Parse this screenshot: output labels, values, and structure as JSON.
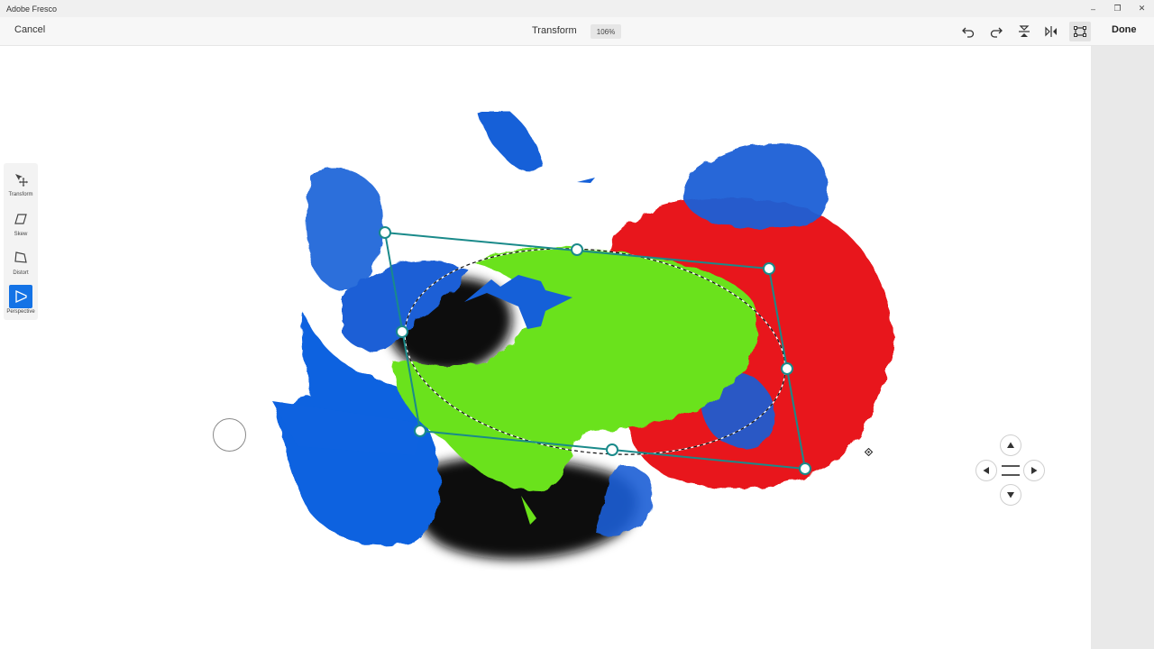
{
  "window": {
    "title": "Adobe Fresco",
    "controls": {
      "minimize": "–",
      "restore": "❐",
      "close": "✕"
    }
  },
  "toolbar": {
    "cancel_label": "Cancel",
    "mode_title": "Transform",
    "zoom": "106%",
    "done_label": "Done",
    "icons": [
      "undo-icon",
      "redo-icon",
      "flip-vertical-icon",
      "flip-horizontal-icon",
      "transform-bounds-icon"
    ]
  },
  "left_panel": {
    "items": [
      {
        "label": "Transform",
        "icon": "transform-move-icon",
        "active": false
      },
      {
        "label": "Skew",
        "icon": "skew-icon",
        "active": false
      },
      {
        "label": "Distort",
        "icon": "distort-icon",
        "active": false
      },
      {
        "label": "Perspective",
        "icon": "perspective-icon",
        "active": true
      }
    ]
  },
  "colors": {
    "accent": "#1473e6",
    "handle_stroke": "#1a8a8a",
    "paint_blue": "#1560d8",
    "paint_red": "#e8181c",
    "paint_green": "#6ae21a",
    "paint_black": "#0a0a0a"
  },
  "nudge": {
    "icons": [
      "arrow-up-icon",
      "arrow-left-icon",
      "arrow-right-icon",
      "arrow-down-icon",
      "drag-handle-icon"
    ]
  }
}
